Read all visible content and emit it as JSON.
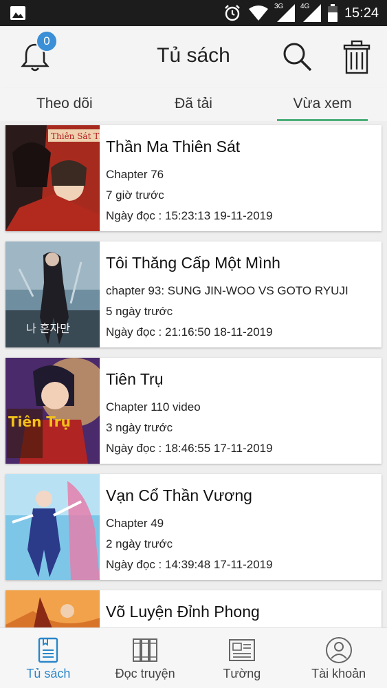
{
  "status_bar": {
    "time": "15:24",
    "signal_3g": "3G",
    "signal_4g": "4G"
  },
  "header": {
    "title": "Tủ sách",
    "notification_count": "0"
  },
  "tabs": [
    {
      "label": "Theo dõi"
    },
    {
      "label": "Đã tải"
    },
    {
      "label": "Vừa xem"
    }
  ],
  "active_tab": "Vừa xem",
  "comics": [
    {
      "title": "Thần Ma Thiên Sát",
      "chapter": "Chapter 76",
      "ago": "7 giờ trước",
      "read": "Ngày đọc : 15:23:13 19-11-2019",
      "cover_text": "Thiên Sát Thần"
    },
    {
      "title": "Tôi Thăng Cấp Một Mình",
      "chapter": "chapter 93: SUNG JIN-WOO VS GOTO RYUJI",
      "ago": "5 ngày trước",
      "read": "Ngày đọc : 21:16:50 18-11-2019",
      "cover_text": "나 혼자만"
    },
    {
      "title": "Tiên Trụ",
      "chapter": "Chapter 110 video",
      "ago": "3 ngày trước",
      "read": "Ngày đọc : 18:46:55 17-11-2019",
      "cover_text": "Tiên Trụ"
    },
    {
      "title": "Vạn Cổ Thần Vương",
      "chapter": "Chapter 49",
      "ago": "2 ngày trước",
      "read": "Ngày đọc : 14:39:48 17-11-2019",
      "cover_text": ""
    },
    {
      "title": "Võ Luyện Đỉnh Phong",
      "chapter": "",
      "ago": "",
      "read": "",
      "cover_text": ""
    }
  ],
  "bottom_nav": [
    {
      "label": "Tủ sách",
      "icon": "bookshelf-icon"
    },
    {
      "label": "Đọc truyện",
      "icon": "books-icon"
    },
    {
      "label": "Tường",
      "icon": "newspaper-icon"
    },
    {
      "label": "Tài khoản",
      "icon": "account-icon"
    }
  ],
  "colors": {
    "accent_tab": "#4caf7a",
    "badge": "#3a8fd6",
    "active_nav": "#2b86c9"
  }
}
